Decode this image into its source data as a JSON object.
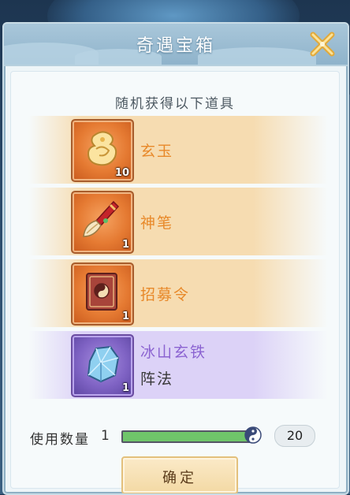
{
  "dialog": {
    "title": "奇遇宝箱",
    "subtitle": "随机获得以下道具"
  },
  "items": [
    {
      "name": "玄玉",
      "count": "10",
      "icon": "jade-icon",
      "rarity": "orange"
    },
    {
      "name": "神笔",
      "count": "1",
      "icon": "brush-icon",
      "rarity": "orange"
    },
    {
      "name": "招募令",
      "count": "1",
      "icon": "recruit-scroll-icon",
      "rarity": "orange"
    },
    {
      "name": "冰山玄铁",
      "sub": "阵法",
      "count": "1",
      "icon": "ice-iron-icon",
      "rarity": "purple"
    }
  ],
  "quantity": {
    "label": "使用数量",
    "value": "1",
    "max": "20",
    "fraction": 1.0
  },
  "confirm_label": "确定",
  "colors": {
    "orange_text": "#e8892a",
    "purple_text": "#8b63d1",
    "slider_fill": "#6fc56a"
  }
}
